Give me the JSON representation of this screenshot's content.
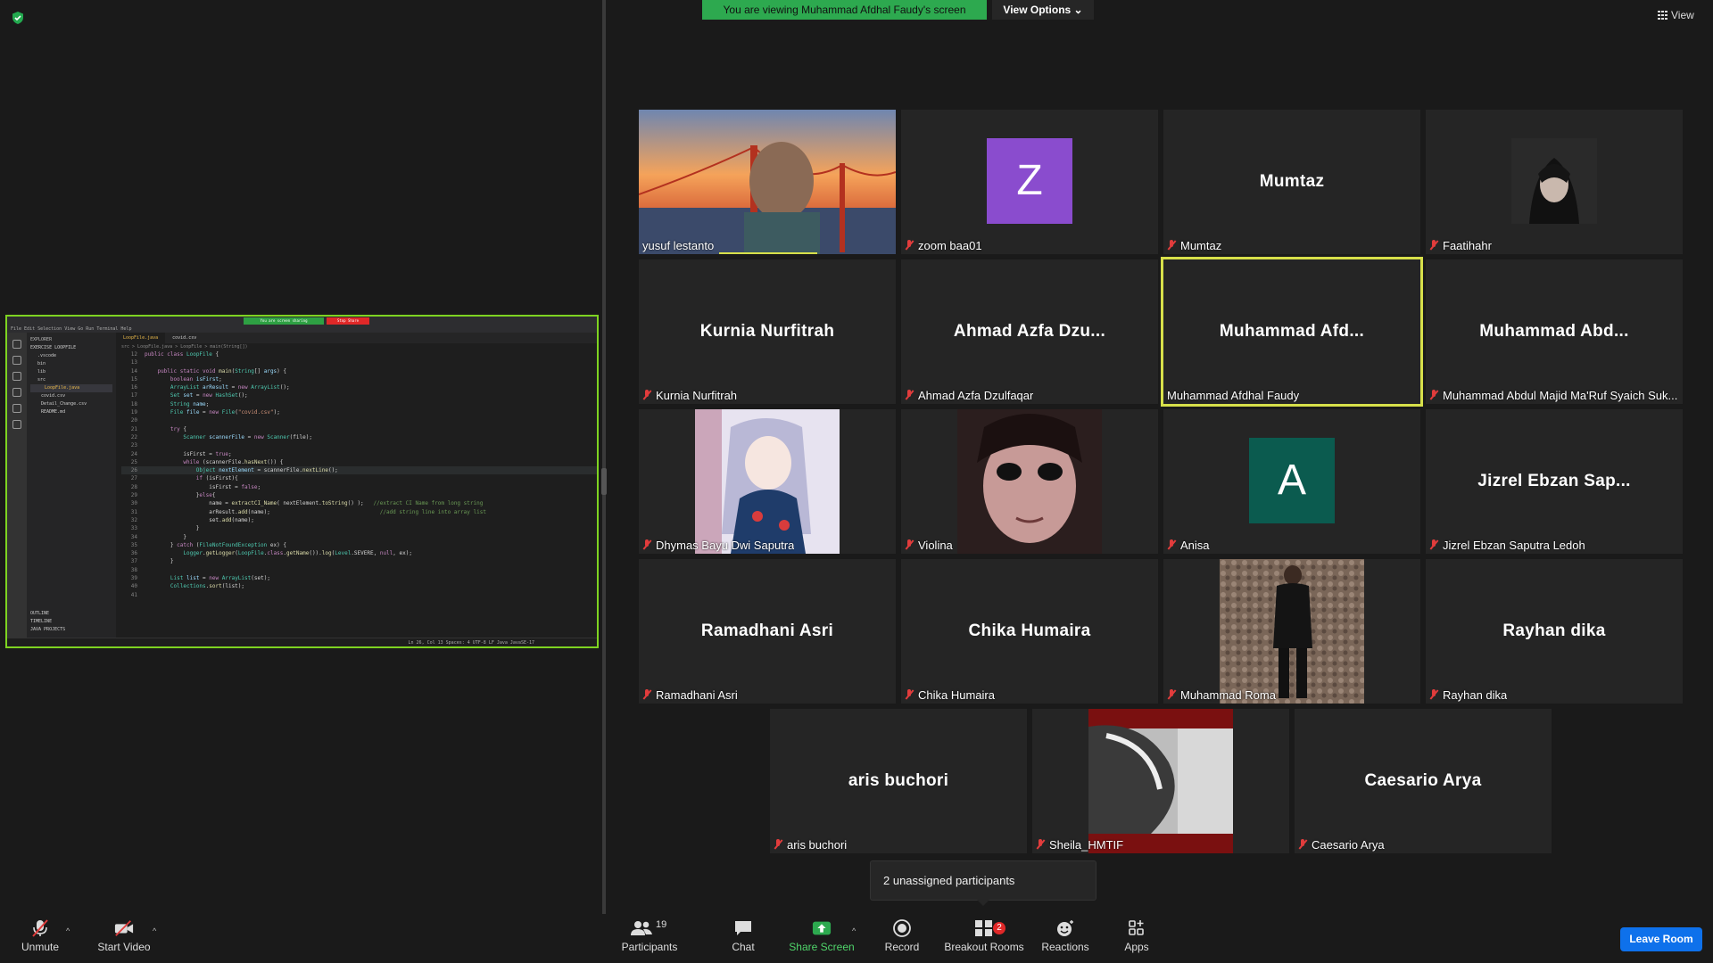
{
  "banner": {
    "viewing_text": "You are viewing Muhammad Afdhal Faudy's screen",
    "view_options": "View Options ⌄",
    "view": "View"
  },
  "vscode": {
    "share_banner": "You are screen sharing",
    "stop_share": "Stop Share",
    "menu": "File  Edit  Selection  View  Go  Run  Terminal  Help",
    "explorer_header": "EXPLORER",
    "project": "EXERCISE LOOPFILE",
    "tree": [
      ".vscode",
      "bin",
      "lib",
      "src",
      "LoopFile.java",
      "covid.csv",
      "Detail_Change.csv",
      "README.md"
    ],
    "outline": [
      "OUTLINE",
      "TIMELINE",
      "JAVA PROJECTS"
    ],
    "tab_active": "LoopFile.java",
    "tab_other": "covid.csv",
    "breadcrumbs": "src > LoopFile.java > LoopFile > main(String[])",
    "status": "Ln 26, Col 13   Spaces: 4   UTF-8   LF   Java   JavaSE-17"
  },
  "tiles": [
    {
      "id": "yusuf",
      "label": "yusuf lestanto",
      "muted": false
    },
    {
      "id": "zoom",
      "label": "zoom baa01",
      "letter": "Z",
      "muted": true
    },
    {
      "id": "mumtaz",
      "big": "Mumtaz",
      "label": "Mumtaz",
      "muted": true
    },
    {
      "id": "faatihahr",
      "label": "Faatihahr",
      "muted": true
    },
    {
      "id": "kurnia",
      "big": "Kurnia Nurfitrah",
      "label": "Kurnia Nurfitrah",
      "muted": true
    },
    {
      "id": "ahmad",
      "big": "Ahmad Azfa Dzu...",
      "label": "Ahmad Azfa Dzulfaqar",
      "muted": true
    },
    {
      "id": "afdhal",
      "big": "Muhammad Afd...",
      "label": "Muhammad Afdhal Faudy",
      "muted": false
    },
    {
      "id": "abdul",
      "big": "Muhammad Abd...",
      "label": "Muhammad Abdul Majid Ma'Ruf Syaich Suk...",
      "muted": true
    },
    {
      "id": "dhymas",
      "label": "Dhymas Bayu Dwi Saputra",
      "muted": true
    },
    {
      "id": "violina",
      "label": "Violina",
      "muted": true
    },
    {
      "id": "anisa",
      "label": "Anisa",
      "letter": "A",
      "muted": true
    },
    {
      "id": "jizrel",
      "big": "Jizrel Ebzan Sap...",
      "label": "Jizrel Ebzan Saputra Ledoh",
      "muted": true
    },
    {
      "id": "ramadhani",
      "big": "Ramadhani Asri",
      "label": "Ramadhani Asri",
      "muted": true
    },
    {
      "id": "chika",
      "big": "Chika Humaira",
      "label": "Chika Humaira",
      "muted": true
    },
    {
      "id": "roma",
      "label": "Muhammad Roma",
      "muted": true
    },
    {
      "id": "rayhan",
      "big": "Rayhan dika",
      "label": "Rayhan dika",
      "muted": true
    },
    {
      "id": "aris",
      "big": "aris buchori",
      "label": "aris buchori",
      "muted": true
    },
    {
      "id": "sheila",
      "label": "Sheila_HMTIF",
      "muted": true
    },
    {
      "id": "caesario",
      "big": "Caesario Arya",
      "label": "Caesario Arya",
      "muted": true
    }
  ],
  "tooltip": "2 unassigned participants",
  "toolbar": {
    "unmute": "Unmute",
    "start_video": "Start Video",
    "participants": "Participants",
    "participants_count": "19",
    "chat": "Chat",
    "share_screen": "Share Screen",
    "record": "Record",
    "breakout_rooms": "Breakout Rooms",
    "breakout_badge": "2",
    "reactions": "Reactions",
    "apps": "Apps",
    "leave_room": "Leave Room"
  },
  "colors": {
    "banner_green": "#2da94f",
    "active_speaker": "#d7e04a",
    "muted_red": "#e23c3c",
    "leave_blue": "#0e71eb",
    "zoom_avatar": "#8a4cce",
    "anisa_avatar": "#0b5b4f"
  }
}
